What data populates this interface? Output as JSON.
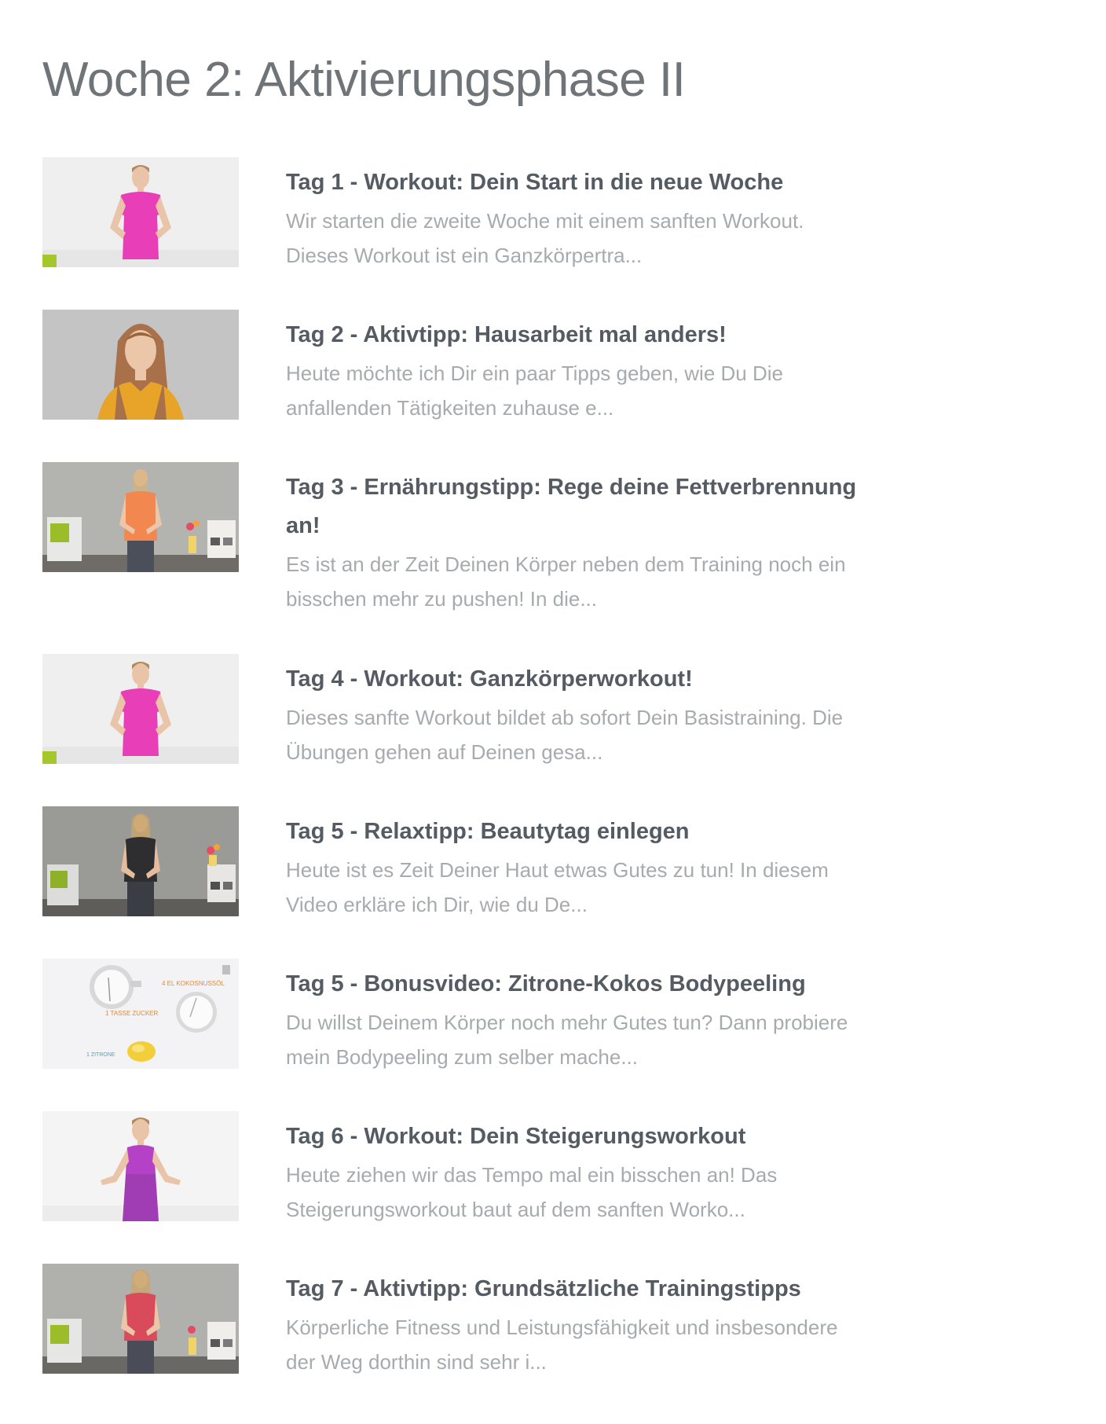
{
  "page": {
    "title": "Woche 2: Aktivierungsphase II"
  },
  "lessons": [
    {
      "title": "Tag 1 - Workout: Dein Start in die neue Woche",
      "desc_line1": "Wir starten die zweite Woche mit einem sanften Workout.",
      "desc_line2": "Dieses Workout ist ein Ganzkörpertra...",
      "thumb": "trainer-pink-shirt-white-studio"
    },
    {
      "title": "Tag 2 - Aktivtipp: Hausarbeit mal anders!",
      "desc_line1": "Heute möchte ich Dir ein paar Tipps geben, wie Du Die",
      "desc_line2": "anfallenden Tätigkeiten zuhause e...",
      "thumb": "trainer-yellow-shirt-grey-background"
    },
    {
      "title_line1": "Tag 3 - Ernährungstipp: Rege deine Fettverbrennung",
      "title_line2": "an!",
      "desc_line1": "Es ist an der Zeit Deinen Körper neben dem Training noch ein",
      "desc_line2": "bisschen mehr zu pushen! In die...",
      "thumb": "trainer-orange-shirt-living-room"
    },
    {
      "title": "Tag 4 - Workout: Ganzkörperworkout!",
      "desc_line1": "Dieses sanfte Workout bildet ab sofort Dein Basistraining. Die",
      "desc_line2": "Übungen gehen auf Deinen gesa...",
      "thumb": "trainer-pink-shirt-white-studio"
    },
    {
      "title": "Tag 5 - Relaxtipp: Beautytag einlegen",
      "desc_line1": "Heute ist es Zeit Deiner Haut etwas Gutes zu tun! In diesem",
      "desc_line2": "Video erkläre ich Dir, wie du De...",
      "thumb": "trainer-black-shirt-living-room"
    },
    {
      "title": "Tag 5 - Bonusvideo: Zitrone-Kokos Bodypeeling",
      "desc_line1": "Du willst Deinem Körper noch mehr Gutes tun? Dann probiere",
      "desc_line2": "mein Bodypeeling zum selber mache...",
      "thumb": "ingredients-flatlay",
      "thumb_labels": [
        "4 EL KOKOSNUSSÖL",
        "1 TASSE ZUCKER",
        "1 ZITRONE"
      ]
    },
    {
      "title": "Tag 6 - Workout: Dein Steigerungsworkout",
      "desc_line1": "Heute ziehen wir das Tempo mal ein bisschen an! Das",
      "desc_line2": "Steigerungsworkout baut auf dem sanften Worko...",
      "thumb": "trainer-purple-top-white-studio"
    },
    {
      "title": "Tag 7 - Aktivtipp: Grundsätzliche Trainingstipps",
      "desc_line1": "Körperliche Fitness und Leistungsfähigkeit und insbesondere",
      "desc_line2": "der Weg dorthin sind sehr i...",
      "thumb": "trainer-red-shirt-living-room"
    }
  ],
  "colors": {
    "heading": "#6f7478",
    "lesson_title": "#545b62",
    "lesson_desc": "#a7abae",
    "background": "#ffffff"
  }
}
